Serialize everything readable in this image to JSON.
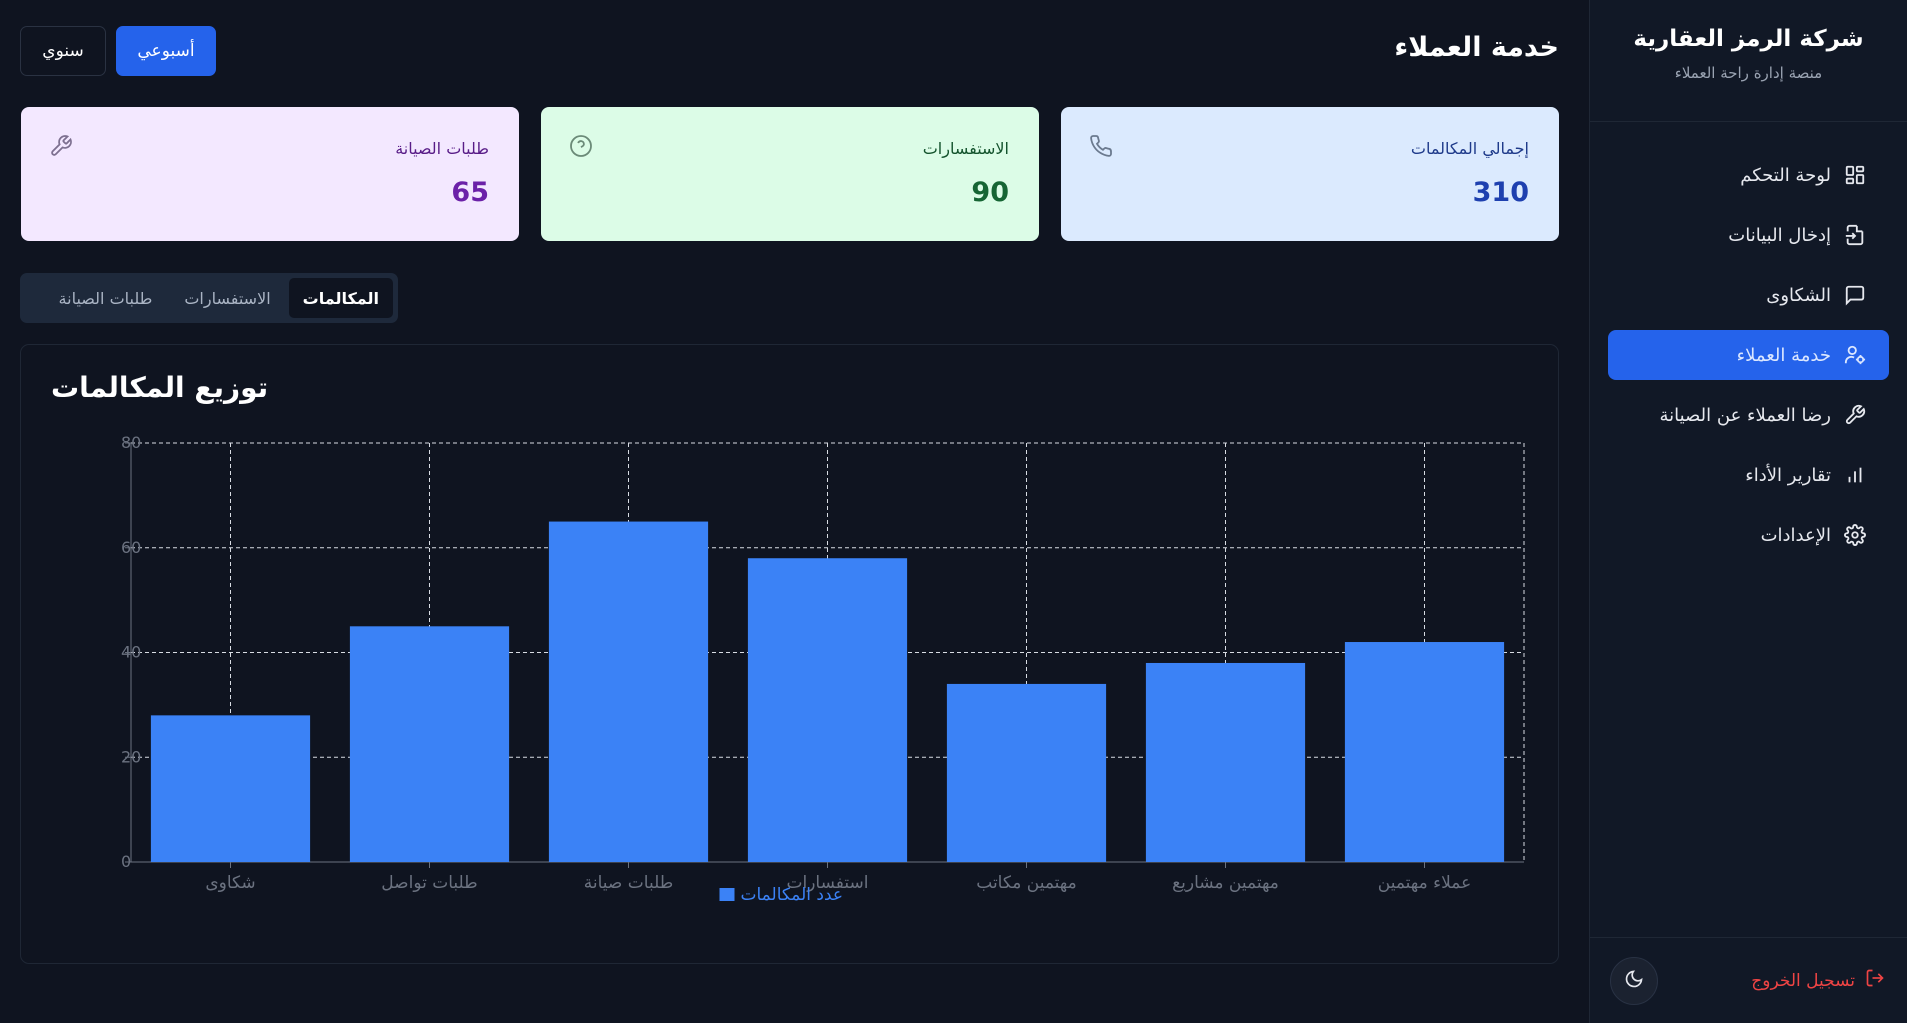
{
  "sidebar": {
    "brand_title": "شركة الرمز العقارية",
    "brand_subtitle": "منصة إدارة راحة العملاء",
    "items": [
      {
        "label": "لوحة التحكم",
        "icon": "dashboard-icon"
      },
      {
        "label": "إدخال البيانات",
        "icon": "file-input-icon"
      },
      {
        "label": "الشكاوى",
        "icon": "message-square-icon"
      },
      {
        "label": "خدمة العملاء",
        "icon": "user-cog-icon",
        "active": true
      },
      {
        "label": "رضا العملاء عن الصيانة",
        "icon": "wrench-icon"
      },
      {
        "label": "تقارير الأداء",
        "icon": "bar-chart-icon"
      },
      {
        "label": "الإعدادات",
        "icon": "gear-icon"
      }
    ],
    "logout_label": "تسجيل الخروج"
  },
  "header": {
    "title": "خدمة العملاء",
    "period_weekly": "أسبوعي",
    "period_annual": "سنوي"
  },
  "cards": {
    "calls": {
      "label": "إجمالي المكالمات",
      "value": "310",
      "icon": "phone-icon"
    },
    "inquiries": {
      "label": "الاستفسارات",
      "value": "90",
      "icon": "help-circle-icon"
    },
    "maintenance": {
      "label": "طلبات الصيانة",
      "value": "65",
      "icon": "wrench-icon"
    }
  },
  "tabs": [
    "المكالمات",
    "الاستفسارات",
    "طلبات الصيانة"
  ],
  "chart_title": "توزيع المكالمات",
  "colors": {
    "accent": "#2563eb",
    "bar": "#3b82f6",
    "logout": "#ef4444"
  },
  "chart_data": {
    "type": "bar",
    "categories": [
      "شكاوى",
      "طلبات تواصل",
      "طلبات صيانة",
      "استفسارات",
      "مهتمين مكاتب",
      "مهتمين مشاريع",
      "عملاء مهتمين"
    ],
    "series": [
      {
        "name": "عدد المكالمات",
        "values": [
          28,
          45,
          65,
          58,
          34,
          38,
          42
        ]
      }
    ],
    "ylim": [
      0,
      80
    ],
    "yticks": [
      0,
      20,
      40,
      60,
      80
    ],
    "grid": true,
    "legend": "bottom"
  }
}
